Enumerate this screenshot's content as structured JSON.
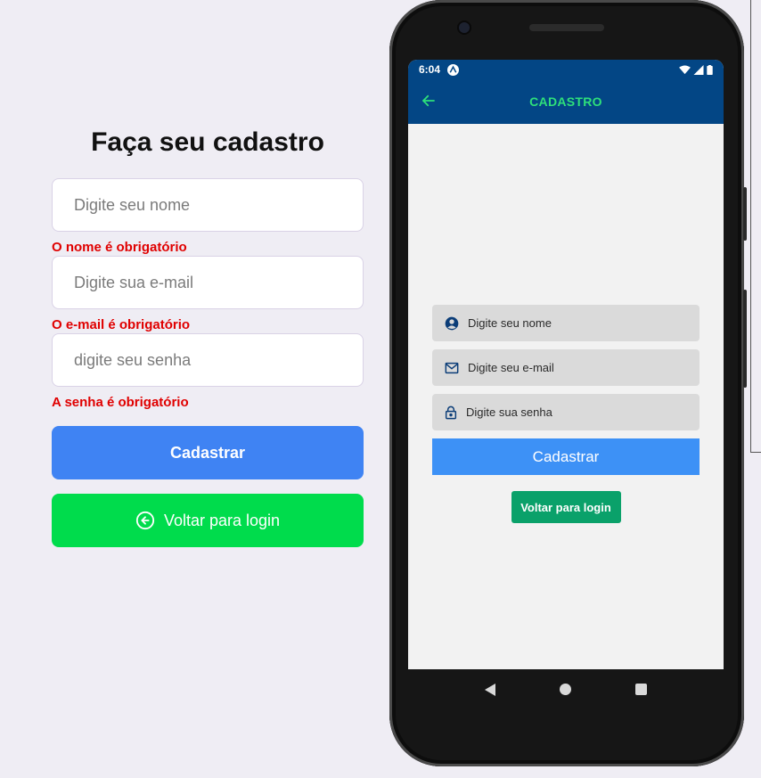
{
  "web": {
    "title": "Faça seu cadastro",
    "name_placeholder": "Digite seu nome",
    "name_error": "O nome é obrigatório",
    "email_placeholder": "Digite sua e-mail",
    "email_error": "O e-mail é obrigatório",
    "password_placeholder": "digite seu senha",
    "password_error": "A senha é obrigatório",
    "submit_label": "Cadastrar",
    "back_label": "Voltar para login",
    "colors": {
      "primary": "#3f83f3",
      "back": "#00dc4c",
      "error": "#e00000"
    }
  },
  "phone": {
    "status": {
      "time": "6:04"
    },
    "header": {
      "title": "CADASTRO",
      "color": "#034685",
      "title_color": "#2ee07a"
    },
    "form": {
      "name_placeholder": "Digite seu nome",
      "email_placeholder": "Digite seu e-mail",
      "password_placeholder": "Digite sua senha",
      "submit_label": "Cadastrar",
      "back_label": "Voltar para login"
    },
    "icons": [
      "back-arrow-icon",
      "user-icon",
      "mail-icon",
      "lock-icon",
      "wifi-icon",
      "signal-icon",
      "battery-icon"
    ]
  }
}
